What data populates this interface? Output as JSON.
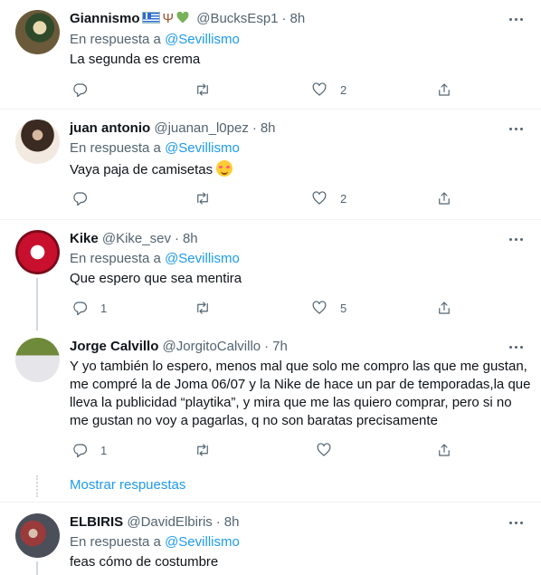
{
  "tweets": [
    {
      "name": "Giannismo",
      "handle": "@BucksEsp1",
      "time": "8h",
      "reply_prefix": "En respuesta a",
      "reply_to": "@Sevillismo",
      "text": "La segunda es crema",
      "replies": "",
      "likes": "2"
    },
    {
      "name": "juan antonio",
      "handle": "@juanan_l0pez",
      "time": "8h",
      "reply_prefix": "En respuesta a",
      "reply_to": "@Sevillismo",
      "text": "Vaya paja de camisetas",
      "replies": "",
      "likes": "2"
    },
    {
      "name": "Kike",
      "handle": "@Kike_sev",
      "time": "8h",
      "reply_prefix": "En respuesta a",
      "reply_to": "@Sevillismo",
      "text": "Que espero que sea mentira",
      "replies": "1",
      "likes": "5"
    },
    {
      "name": "Jorge Calvillo",
      "handle": "@JorgitoCalvillo",
      "time": "7h",
      "text": "Y yo también lo espero, menos mal que solo me compro las que me gustan, me compré la de Joma 06/07 y la Nike de hace un par de temporadas,la que lleva la publicidad “playtika”, y mira que me las quiero comprar, pero si no me gustan no voy a pagarlas, q no son baratas precisamente",
      "replies": "1",
      "likes": ""
    },
    {
      "name": "ELBIRIS",
      "handle": "@DavidElbiris",
      "time": "8h",
      "reply_prefix": "En respuesta a",
      "reply_to": "@Sevillismo",
      "text": "feas cómo de costumbre"
    }
  ],
  "show_replies": "Mostrar respuestas",
  "colors": {
    "link": "#1d9bf0",
    "muted": "#536471",
    "text": "#0f1419",
    "divider": "#eff3f4"
  },
  "icons": [
    "reply-icon",
    "retweet-icon",
    "like-icon",
    "share-icon",
    "more-icon"
  ]
}
